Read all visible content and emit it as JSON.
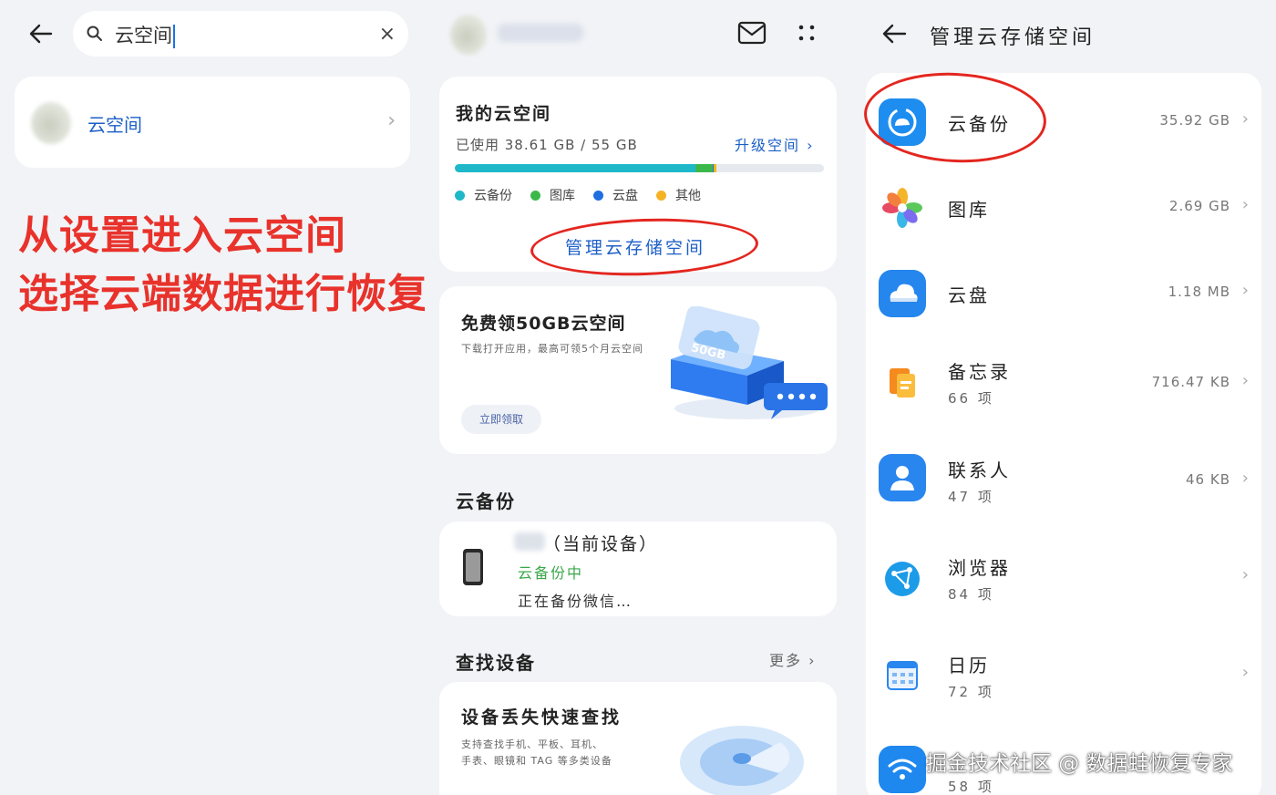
{
  "search": {
    "query": "云空间",
    "clear_glyph": "×",
    "result_label": "云空间"
  },
  "caption": {
    "line1": "从设置进入云空间",
    "line2": "选择云端数据进行恢复"
  },
  "cloud": {
    "my_space_title": "我的云空间",
    "used_text": "已使用  38.61 GB / 55 GB",
    "upgrade_label": "升级空间",
    "legend": [
      {
        "label": "云备份",
        "color": "#1fb8c9"
      },
      {
        "label": "图库",
        "color": "#3cb84a"
      },
      {
        "label": "云盘",
        "color": "#1e6fe0"
      },
      {
        "label": "其他",
        "color": "#f4b324"
      }
    ],
    "usage_fraction": {
      "backup": 0.653,
      "gallery": 0.045,
      "drive": 0.004,
      "other": 0.006
    },
    "manage_label": "管理云存储空间"
  },
  "promo": {
    "title": "免费领50GB云空间",
    "desc": "下载打开应用，最高可领5个月云空间",
    "button": "立即领取",
    "badge": "50GB"
  },
  "backup": {
    "section_title": "云备份",
    "device_suffix": "（当前设备）",
    "status": "云备份中",
    "progress_text": "正在备份微信…"
  },
  "find": {
    "section_title": "查找设备",
    "more": "更多",
    "card_title": "设备丢失快速查找",
    "card_desc_1": "支持查找手机、平板、耳机、",
    "card_desc_2": "手表、眼镜和 TAG 等多类设备"
  },
  "manage": {
    "title": "管理云存储空间",
    "items": [
      {
        "name": "云备份",
        "sub": "",
        "size": "35.92 GB",
        "icon": "cloud-backup-icon"
      },
      {
        "name": "图库",
        "sub": "",
        "size": "2.69 GB",
        "icon": "gallery-icon"
      },
      {
        "name": "云盘",
        "sub": "",
        "size": "1.18 MB",
        "icon": "cloud-drive-icon"
      },
      {
        "name": "备忘录",
        "sub": "66 项",
        "size": "716.47 KB",
        "icon": "notes-icon"
      },
      {
        "name": "联系人",
        "sub": "47 项",
        "size": "46 KB",
        "icon": "contacts-icon"
      },
      {
        "name": "浏览器",
        "sub": "84 项",
        "size": "",
        "icon": "browser-icon"
      },
      {
        "name": "日历",
        "sub": "72 项",
        "size": "",
        "icon": "calendar-icon"
      },
      {
        "name": "",
        "sub": "58 项",
        "size": "",
        "icon": "wifi-icon"
      }
    ]
  },
  "watermark": "掘金技术社区 @ 数据蛙恢复专家",
  "colors": {
    "accent": "#1d5fc7",
    "annotation": "#e3261f",
    "caption": "#e8322b"
  }
}
